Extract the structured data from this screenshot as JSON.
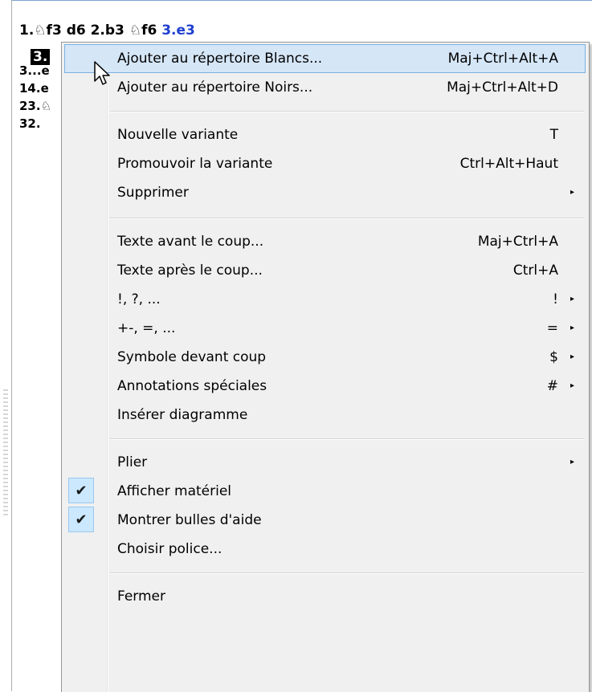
{
  "notation": {
    "line1_pre": "1.",
    "line1_mid": "f3  d6  2.b3  ",
    "line1_mid2": "f6  ",
    "line1_current": "3.e3",
    "line2_hl": "3.",
    "line3": "3...e",
    "line4": "14.e",
    "line5": "23.",
    "line6": "32.",
    "knight_glyph": "♘"
  },
  "menu": {
    "items": [
      {
        "label": "Ajouter au répertoire Blancs...",
        "shortcut": "Maj+Ctrl+Alt+A"
      },
      {
        "label": "Ajouter au répertoire Noirs...",
        "shortcut": "Maj+Ctrl+Alt+D"
      },
      {
        "label": "Nouvelle variante",
        "shortcut": "T"
      },
      {
        "label": "Promouvoir la variante",
        "shortcut": "Ctrl+Alt+Haut"
      },
      {
        "label": "Supprimer",
        "shortcut": ""
      },
      {
        "label": "Texte avant le coup...",
        "shortcut": "Maj+Ctrl+A"
      },
      {
        "label": "Texte après le coup...",
        "shortcut": "Ctrl+A"
      },
      {
        "label": "!, ?, ...",
        "shortcut": "!"
      },
      {
        "label": "+-, =, ...",
        "shortcut": "="
      },
      {
        "label": "Symbole devant coup",
        "shortcut": "$"
      },
      {
        "label": "Annotations spéciales",
        "shortcut": "#"
      },
      {
        "label": "Insérer diagramme",
        "shortcut": ""
      },
      {
        "label": "Plier",
        "shortcut": ""
      },
      {
        "label": "Afficher matériel",
        "shortcut": ""
      },
      {
        "label": "Montrer bulles d'aide",
        "shortcut": ""
      },
      {
        "label": "Choisir police...",
        "shortcut": ""
      },
      {
        "label": "Fermer",
        "shortcut": ""
      }
    ],
    "submenu_arrow": "▸",
    "checkmark": "✔"
  }
}
